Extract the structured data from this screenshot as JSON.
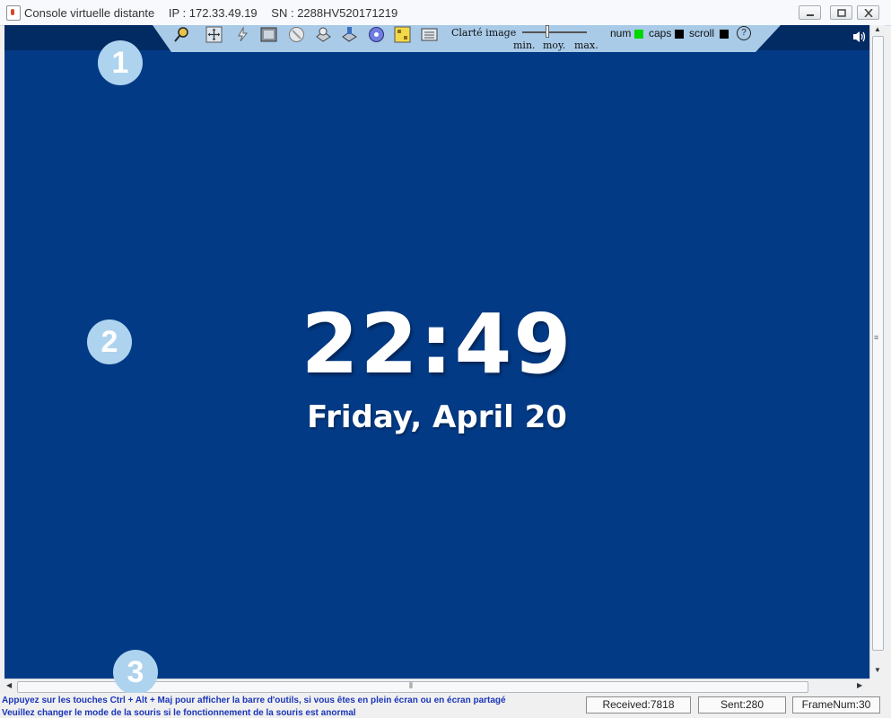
{
  "window": {
    "title": "Console virtuelle distante",
    "ip": "IP : 172.33.49.19",
    "sn": "SN : 2288HV520171219",
    "controls": [
      "minimize-icon",
      "maximize-icon",
      "close-icon"
    ]
  },
  "toolbar": {
    "icons": [
      "pin-icon",
      "move-icon",
      "power-icon",
      "screenshot-icon",
      "record-icon",
      "floppy-icon",
      "drive-icon",
      "cdrom-icon",
      "image-icon",
      "keyboard-icon"
    ],
    "clarity_label": "Clarté image",
    "slider": {
      "min_label": "min.",
      "mid_label": "moy.",
      "max_label": "max.",
      "level": "moy."
    },
    "indicators": [
      {
        "label": "num",
        "color": "#00d600"
      },
      {
        "label": "caps",
        "color": "#000000"
      },
      {
        "label": "scroll",
        "color": "#000000"
      }
    ],
    "help": "?"
  },
  "screen": {
    "background": "#033a86",
    "time": "22:49",
    "date": "Friday, April 20"
  },
  "markers": [
    "1",
    "2",
    "3"
  ],
  "status": {
    "hint1": "Appuyez sur les touches Ctrl + Alt + Maj pour afficher la barre d'outils, si vous êtes en plein écran ou en écran partagé",
    "hint2": "Veuillez changer le mode de la souris si le fonctionnement de la souris est anormal",
    "received": "Received:7818",
    "sent": "Sent:280",
    "frames": "FrameNum:30"
  }
}
